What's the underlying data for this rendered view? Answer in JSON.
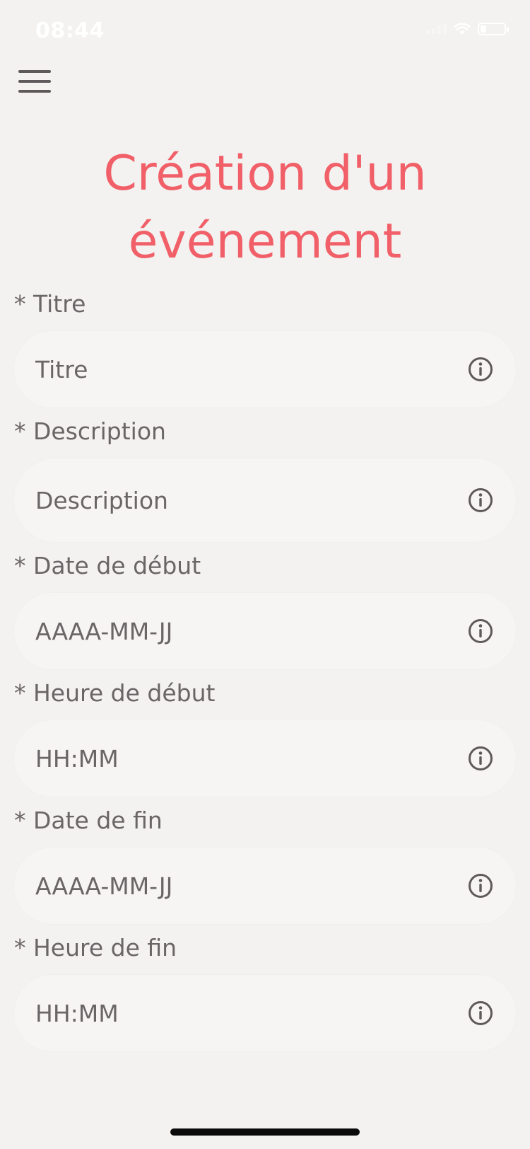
{
  "status_bar": {
    "time": "08:44",
    "battery_level": 0.25
  },
  "header": {
    "menu_icon": "hamburger-menu-icon",
    "title_line1": "Création d'un",
    "title_line2": "événement"
  },
  "colors": {
    "accent": "#f16068",
    "text": "#6a6567",
    "background": "#f3f2f1",
    "input_background": "#f7f4f4"
  },
  "form": {
    "fields": [
      {
        "label": "* Titre",
        "placeholder": "Titre",
        "icon": "info-icon"
      },
      {
        "label": "* Description",
        "placeholder": "Description",
        "icon": "info-icon"
      },
      {
        "label": "* Date de début",
        "placeholder": "AAAA-MM-JJ",
        "icon": "info-icon"
      },
      {
        "label": "* Heure de début",
        "placeholder": "HH:MM",
        "icon": "info-icon"
      },
      {
        "label": "* Date de fin",
        "placeholder": "AAAA-MM-JJ",
        "icon": "info-icon"
      },
      {
        "label": "* Heure de fin",
        "placeholder": "HH:MM",
        "icon": "info-icon"
      }
    ]
  }
}
